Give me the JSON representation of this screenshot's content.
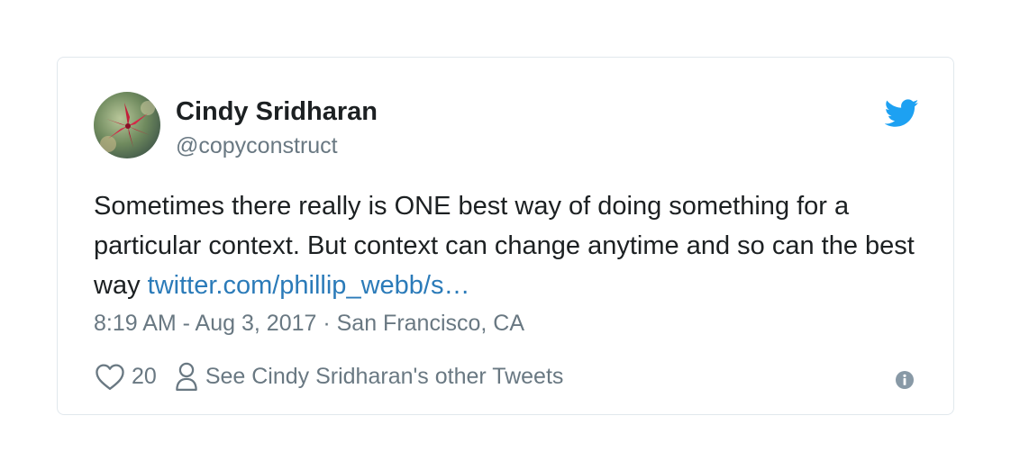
{
  "tweet": {
    "author_name": "Cindy Sridharan",
    "author_handle": "@copyconstruct",
    "text_main": "Sometimes there really is ONE best way of doing something for a particular context. But context can change anytime and so can the best way ",
    "link_text": "twitter.com/phillip_webb/s…",
    "timestamp": "8:19 AM - Aug 3, 2017",
    "separator": " · ",
    "location": "San Francisco, CA",
    "like_count": "20",
    "other_tweets_label": "See Cindy Sridharan's other Tweets"
  },
  "icons": {
    "brand": "twitter-bird-icon",
    "like": "heart-icon",
    "profile": "person-icon",
    "info": "info-icon"
  },
  "colors": {
    "brand_blue": "#1da1f2",
    "link_blue": "#2b7bb9",
    "text": "#1c2022",
    "muted": "#697882",
    "border": "#e1e8ed"
  }
}
